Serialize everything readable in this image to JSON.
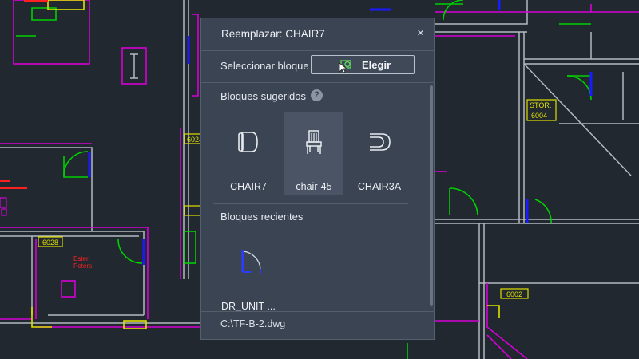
{
  "dialog": {
    "title": "Reemplazar: CHAIR7",
    "close_glyph": "×",
    "select_label": "Seleccionar bloque",
    "choose_button": "Elegir",
    "suggested_title": "Bloques sugeridos",
    "help_glyph": "?",
    "suggested": [
      {
        "label": "CHAIR7",
        "icon": "chair-top-icon",
        "selected": false
      },
      {
        "label": "chair-45",
        "icon": "chair-front-icon",
        "selected": true
      },
      {
        "label": "CHAIR3A",
        "icon": "chair-side-icon",
        "selected": false
      }
    ],
    "recent_title": "Bloques recientes",
    "recent": [
      {
        "label": "DR_UNIT ...",
        "icon": "door-unit-icon"
      }
    ],
    "footer_path": "C:\\TF-B-2.dwg"
  },
  "drawing": {
    "room_tags": [
      "6028",
      "6024",
      "6002",
      "6004"
    ],
    "stor_label": "STOR.",
    "red_labels": [
      "Ester",
      "Peters"
    ],
    "colors": {
      "background": "#212830",
      "walls": "#b4b9bf",
      "magenta": "#d600d6",
      "green": "#00d000",
      "blue": "#1a1aff",
      "yellow": "#e0e000",
      "red": "#ff2020"
    }
  }
}
